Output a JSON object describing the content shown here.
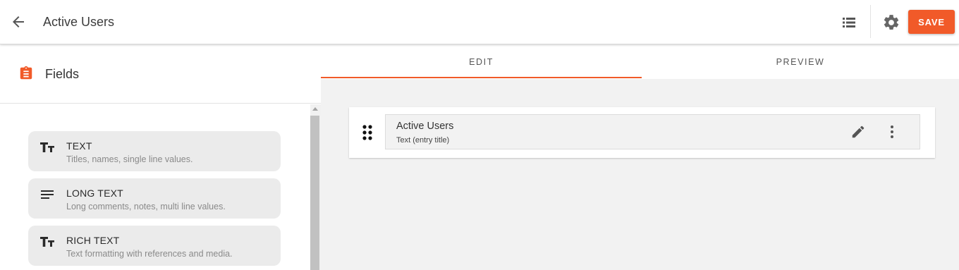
{
  "header": {
    "title": "Active Users",
    "save_label": "SAVE",
    "icons": [
      "arrow-left-icon",
      "list-icon",
      "gear-icon"
    ]
  },
  "fields_panel": {
    "title": "Fields",
    "icon": "clipboard-icon",
    "items": [
      {
        "name": "TEXT",
        "description": "Titles, names, single line values.",
        "icon": "text-format-icon"
      },
      {
        "name": "LONG TEXT",
        "description": "Long comments, notes, multi line values.",
        "icon": "lines-icon"
      },
      {
        "name": "RICH TEXT",
        "description": "Text formatting with references and media.",
        "icon": "text-format-icon"
      }
    ]
  },
  "tabs": [
    {
      "label": "EDIT",
      "active": true
    },
    {
      "label": "PREVIEW",
      "active": false
    }
  ],
  "entry": {
    "name": "Active Users",
    "type": "Text (entry title)"
  },
  "colors": {
    "accent": "#f15a29",
    "card_bg": "#ebebeb",
    "canvas_bg": "#f2f2f2"
  }
}
